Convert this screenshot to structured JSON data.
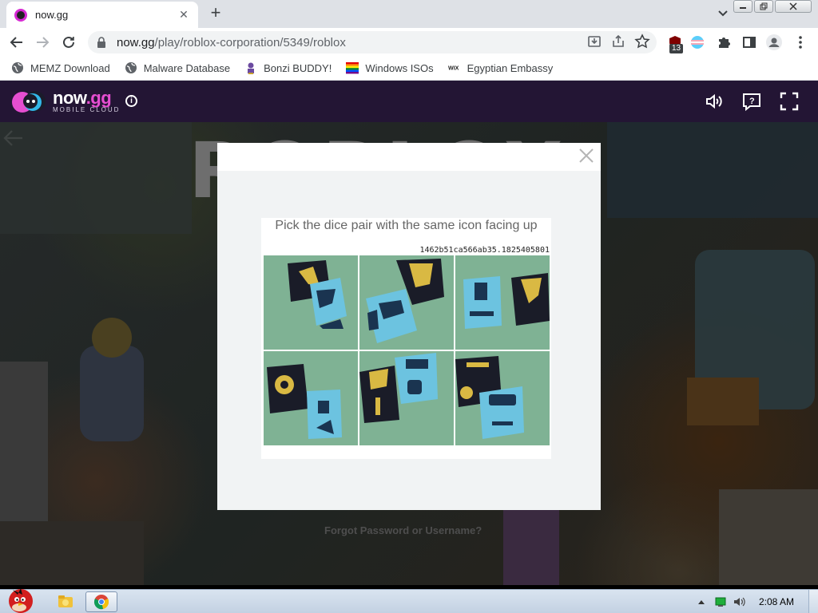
{
  "browser": {
    "tab_title": "now.gg",
    "url_host": "now.gg",
    "url_path": "/play/roblox-corporation/5349/roblox",
    "extension_badge": "13",
    "bookmarks": [
      {
        "label": "MEMZ Download",
        "icon": "globe-icon"
      },
      {
        "label": "Malware Database",
        "icon": "globe-icon"
      },
      {
        "label": "Bonzi BUDDY!",
        "icon": "bonzi-icon"
      },
      {
        "label": "Windows ISOs",
        "icon": "windows-flag-icon"
      },
      {
        "label": "Egyptian Embassy",
        "icon": "wix-icon"
      }
    ]
  },
  "site": {
    "logo_main": "now",
    "logo_dot": ".gg",
    "logo_sub": "MOBILE CLOUD"
  },
  "game": {
    "bg_title": "ROBLOX",
    "forgot_link": "Forgot Password or Username?"
  },
  "captcha": {
    "prompt": "Pick the dice pair with the same icon facing up",
    "challenge_id": "1462b51ca566ab35.1825405801",
    "cells": [
      {
        "label": "dice-option-1"
      },
      {
        "label": "dice-option-2"
      },
      {
        "label": "dice-option-3"
      },
      {
        "label": "dice-option-4"
      },
      {
        "label": "dice-option-5"
      },
      {
        "label": "dice-option-6"
      }
    ]
  },
  "taskbar": {
    "clock": "2:08 AM"
  },
  "colors": {
    "site_header": "#231534",
    "accent_pink": "#e64ed1",
    "dice_blue": "#6cc3e0",
    "dice_black": "#1a1c28",
    "captcha_bg": "#7fb294"
  }
}
